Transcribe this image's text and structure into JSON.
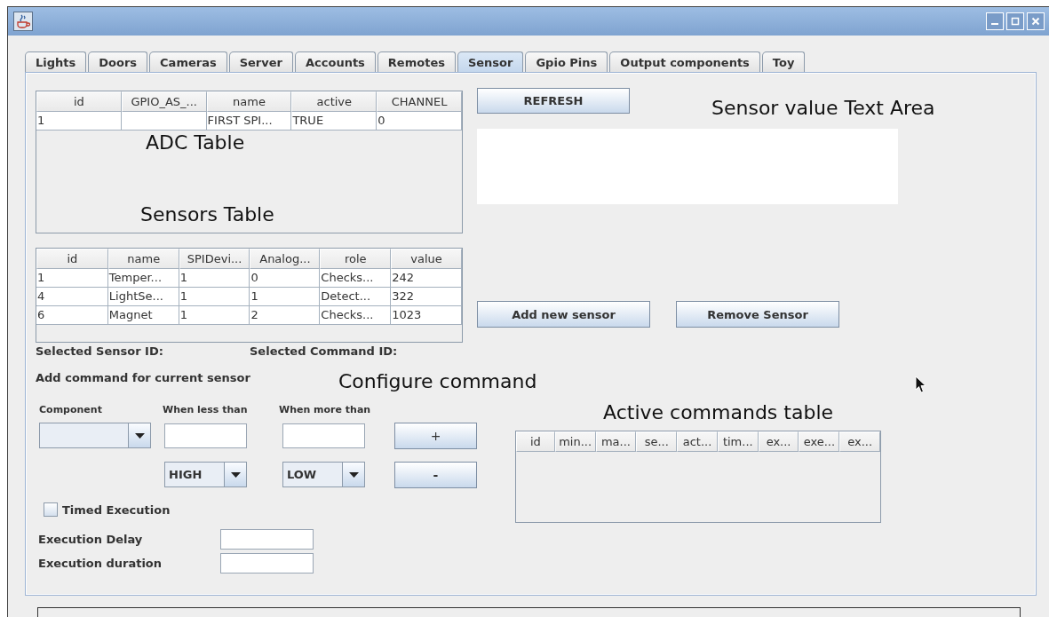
{
  "tabs": [
    {
      "label": "Lights",
      "selected": false
    },
    {
      "label": "Doors",
      "selected": false
    },
    {
      "label": "Cameras",
      "selected": false
    },
    {
      "label": "Server",
      "selected": false
    },
    {
      "label": "Accounts",
      "selected": false
    },
    {
      "label": "Remotes",
      "selected": false
    },
    {
      "label": "Sensor",
      "selected": true
    },
    {
      "label": "Gpio Pins",
      "selected": false
    },
    {
      "label": "Output components",
      "selected": false
    },
    {
      "label": "Toy",
      "selected": false
    }
  ],
  "adc_table": {
    "columns": [
      "id",
      "GPIO_AS_...",
      "name",
      "active",
      "CHANNEL"
    ],
    "rows": [
      [
        "1",
        null,
        "FIRST SPI...",
        "TRUE",
        "0"
      ]
    ]
  },
  "adc_caption": "ADC Table",
  "sensors_caption": "Sensors Table",
  "sensors_table": {
    "columns": [
      "id",
      "name",
      "SPIDevi...",
      "Analog...",
      "role",
      "value"
    ],
    "rows": [
      [
        "1",
        "Temper...",
        "1",
        "0",
        "Checks...",
        "242"
      ],
      [
        "4",
        "LightSe...",
        "1",
        "1",
        "Detect...",
        "322"
      ],
      [
        "6",
        "Magnet",
        "1",
        "2",
        "Checks...",
        "1023"
      ]
    ]
  },
  "refresh_button": "REFRESH",
  "text_area_caption": "Sensor value Text Area",
  "sensor_buttons": [
    "Add new sensor",
    "Remove Sensor"
  ],
  "selected_sensor_label": "Selected Sensor ID:",
  "selected_command_label": "Selected Command ID:",
  "add_command_label": "Add command for current sensor",
  "configure_caption": "Configure command",
  "command_form": {
    "component_label": "Component",
    "less_label": "When less than",
    "more_label": "When more than",
    "less_state": "HIGH",
    "more_state": "LOW",
    "add_button": "+",
    "remove_button": "-",
    "timed_execution": {
      "label": "Timed Execution",
      "checked": false
    },
    "delay_label": "Execution Delay",
    "duration_label": "Execution duration"
  },
  "active_commands": {
    "caption": "Active commands table",
    "columns": [
      "id",
      "min...",
      "ma...",
      "se...",
      "act...",
      "tim...",
      "ex...",
      "exe...",
      "ex..."
    ]
  }
}
